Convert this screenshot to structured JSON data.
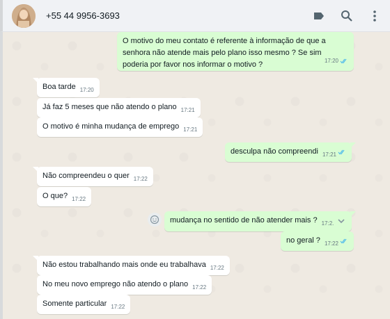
{
  "header": {
    "contact_name": "+55 44 9956-3693",
    "icons": [
      "label-icon",
      "search-icon",
      "menu-icon"
    ]
  },
  "colors": {
    "incoming": "#ffffff",
    "outgoing": "#d9fdd3",
    "read_ticks": "#53bdeb",
    "background": "#efeae2"
  },
  "messages": [
    {
      "dir": "out",
      "text": "O motivo do meu contato é referente à informação de que a senhora não atende mais pelo plano isso mesmo ? Se sim poderia por favor nos informar o motivo ?",
      "time": "17:20",
      "status": "read"
    },
    {
      "dir": "in",
      "text": "Boa tarde",
      "time": "17:20"
    },
    {
      "dir": "in",
      "text": "Já faz 5 meses que não atendo o plano",
      "time": "17:21"
    },
    {
      "dir": "in",
      "text": "O motivo é minha mudança de emprego",
      "time": "17:21"
    },
    {
      "dir": "out",
      "text": "desculpa não compreendi",
      "time": "17:21",
      "status": "read"
    },
    {
      "dir": "in",
      "text": "Não compreendeu o quer",
      "time": "17:22"
    },
    {
      "dir": "in",
      "text": "O que?",
      "time": "17:22"
    },
    {
      "dir": "out",
      "text": "mudança no sentido de não atender mais ?",
      "time": "17:2.",
      "status": "read"
    },
    {
      "dir": "out",
      "text": "no geral ?",
      "time": "17:22",
      "status": "read"
    },
    {
      "dir": "in",
      "text": "Não estou trabalhando mais onde eu trabalhava",
      "time": "17:22"
    },
    {
      "dir": "in",
      "text": "No meu novo emprego não atendo o plano",
      "time": "17:22"
    },
    {
      "dir": "in",
      "text": "Somente particular",
      "time": "17:22"
    }
  ]
}
